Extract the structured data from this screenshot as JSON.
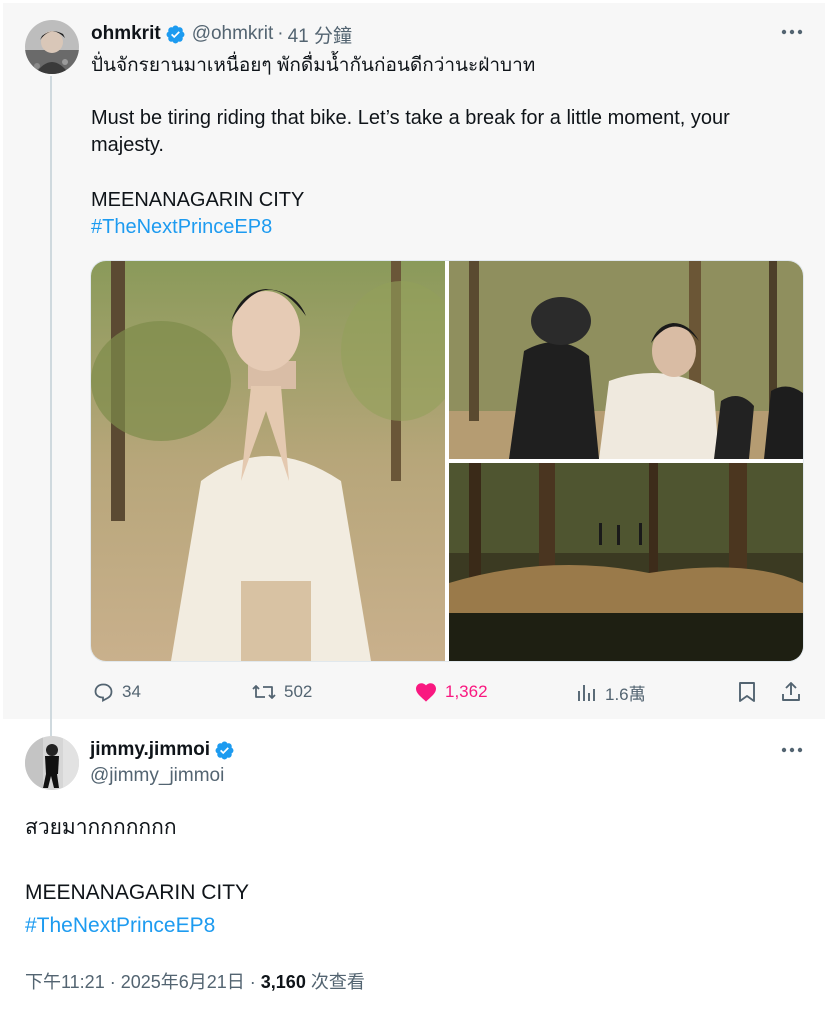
{
  "parent_tweet": {
    "display_name": "ohmkrit",
    "handle": "@ohmkrit",
    "separator": "·",
    "time": "41 分鐘",
    "text_thai": "ปั่นจักรยานมาเหนื่อยๆ พักดื่มน้ำกันก่อนดีกว่านะฝ่าบาท",
    "text_english": "Must be tiring riding that bike. Let’s take a break for a little moment, your majesty.",
    "text_city": "MEENANAGARIN CITY",
    "hashtag": "#TheNextPrinceEP8",
    "stats": {
      "replies": "34",
      "reposts": "502",
      "likes": "1,362",
      "views": "1.6萬"
    }
  },
  "reply_tweet": {
    "display_name": "jimmy.jimmoi",
    "handle": "@jimmy_jimmoi",
    "text_thai": "สวยมากกกกกกก",
    "text_city": "MEENANAGARIN CITY",
    "hashtag": "#TheNextPrinceEP8",
    "timestamp": "下午11:21 · 2025年6月21日 · ",
    "views_count": "3,160",
    "views_label": " 次查看"
  },
  "icons": {
    "verified": "verified-badge-icon",
    "more": "more-dots-icon",
    "reply": "reply-icon",
    "repost": "repost-icon",
    "like": "heart-icon",
    "views": "views-chart-icon",
    "bookmark": "bookmark-icon",
    "share": "share-icon"
  },
  "colors": {
    "accent": "#1d9bf0",
    "like": "#f91880",
    "secondary_text": "#536471",
    "primary_text": "#0f1419"
  }
}
